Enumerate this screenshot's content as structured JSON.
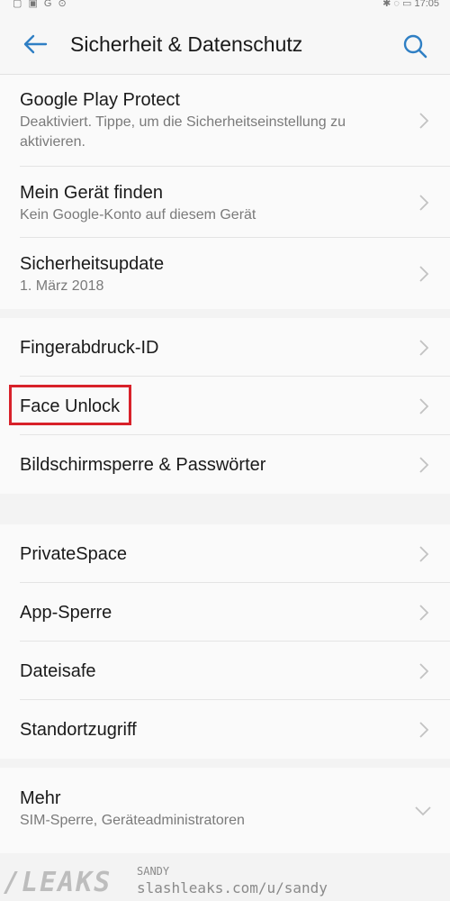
{
  "statusbar": {
    "left_icons": "▢ ▣ G ⊙",
    "right": "✱ ◌ ▭ 17:05"
  },
  "appbar": {
    "title": "Sicherheit & Datenschutz"
  },
  "section1": {
    "items": [
      {
        "title": "Google Play Protect",
        "subtitle": "Deaktiviert. Tippe, um die Sicherheitseinstellung zu aktivieren."
      },
      {
        "title": "Mein Gerät finden",
        "subtitle": "Kein Google-Konto auf diesem Gerät"
      },
      {
        "title": "Sicherheitsupdate",
        "subtitle": "1. März 2018"
      }
    ]
  },
  "section2": {
    "items": [
      {
        "title": "Fingerabdruck-ID"
      },
      {
        "title": "Face Unlock"
      },
      {
        "title": "Bildschirmsperre & Passwörter"
      }
    ]
  },
  "section3": {
    "items": [
      {
        "title": "PrivateSpace"
      },
      {
        "title": "App-Sperre"
      },
      {
        "title": "Dateisafe"
      },
      {
        "title": "Standortzugriff"
      }
    ]
  },
  "section4": {
    "items": [
      {
        "title": "Mehr",
        "subtitle": "SIM-Sperre, Geräteadministratoren"
      }
    ]
  },
  "watermark": {
    "logo": "/LEAKS",
    "handle": "SANDY",
    "url": "slashleaks.com/u/sandy"
  },
  "colors": {
    "accent": "#2f7fc4",
    "highlight": "#d8212a"
  }
}
